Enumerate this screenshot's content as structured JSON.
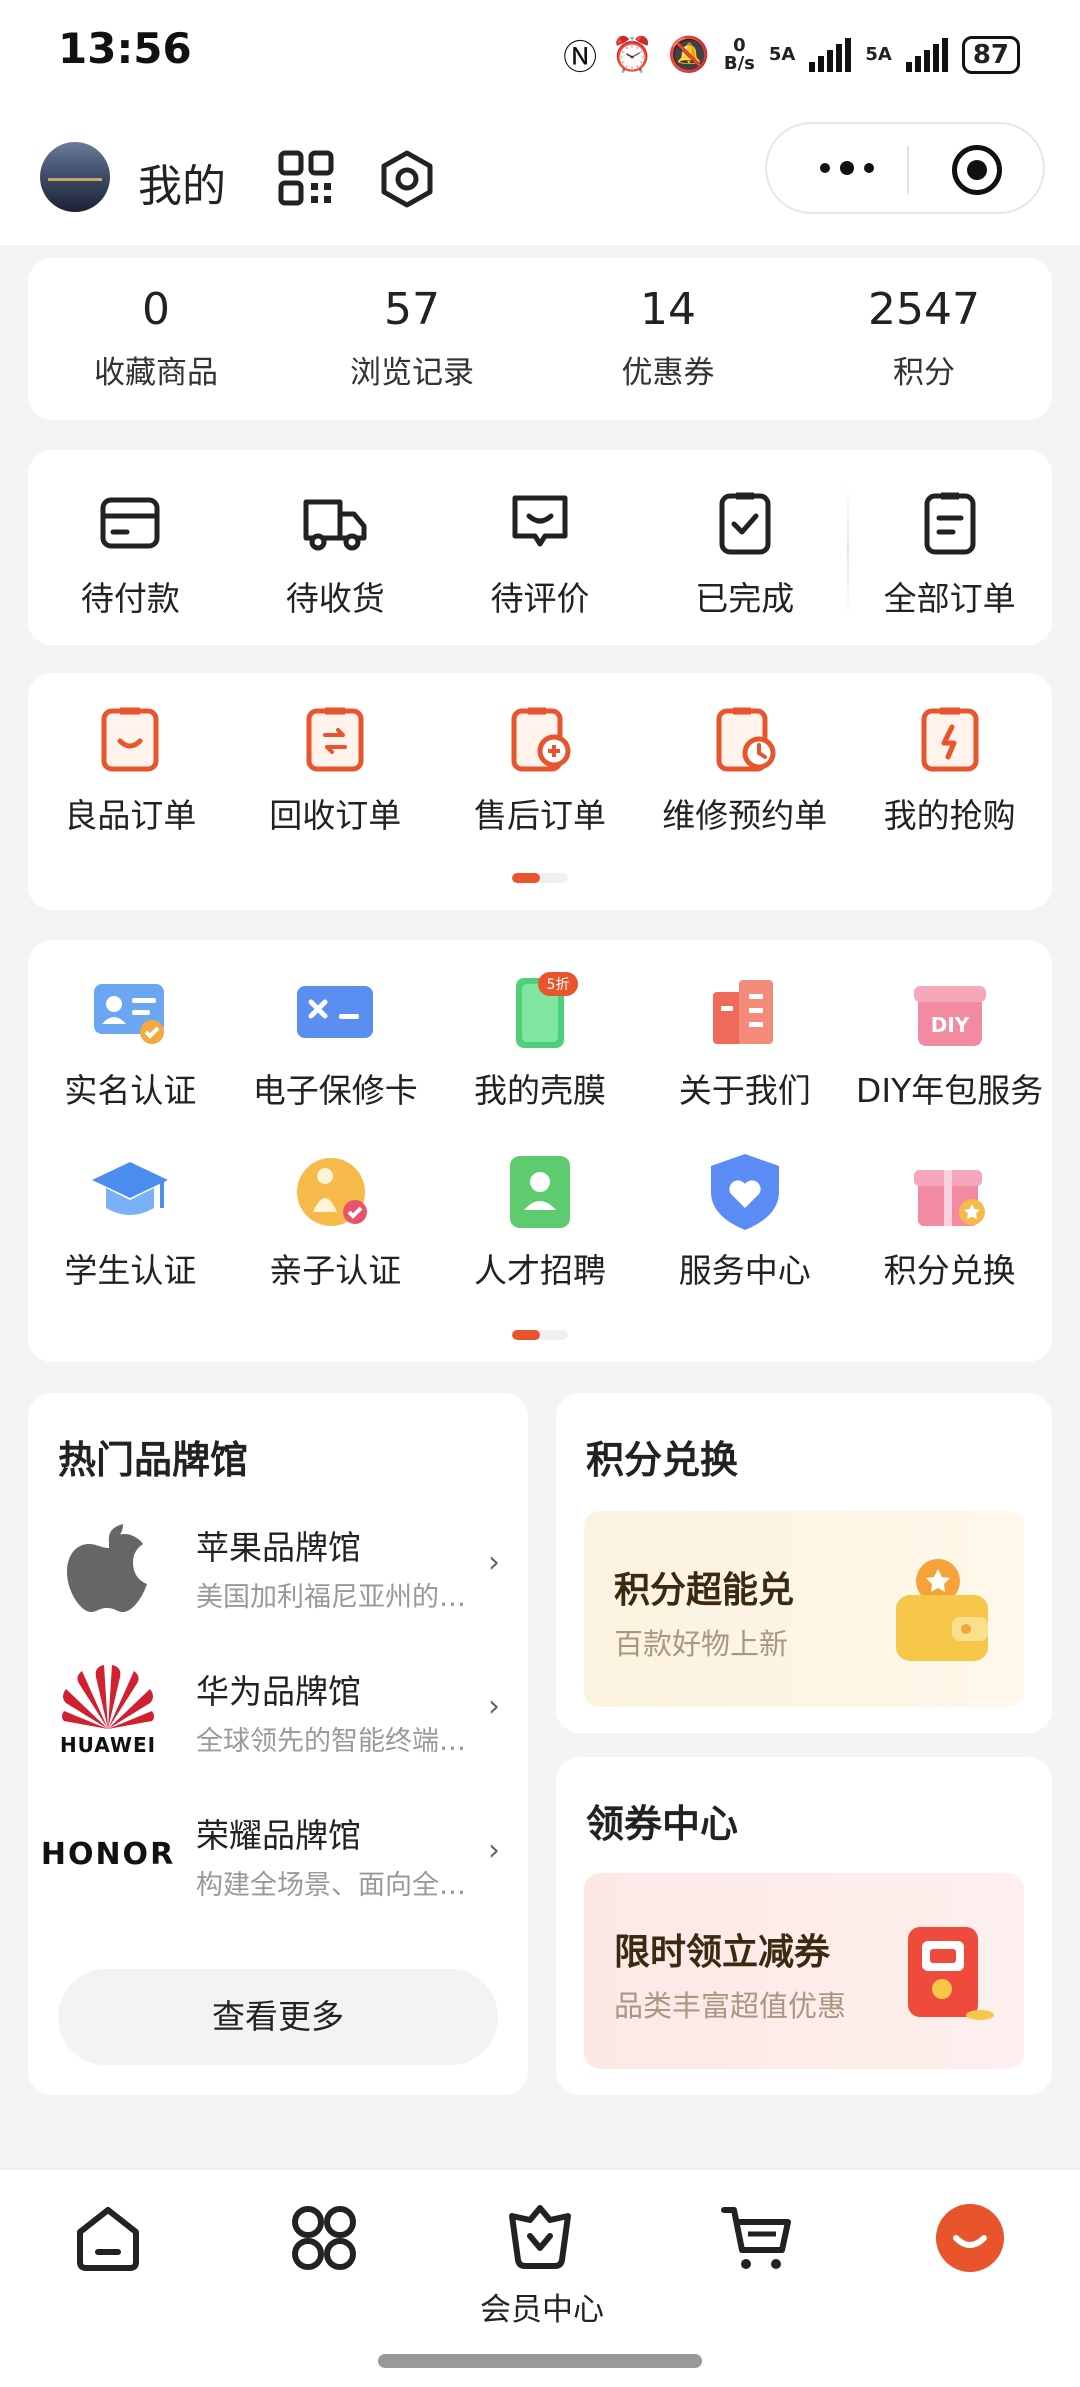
{
  "status_bar": {
    "time": "13:56",
    "net_speed_value": "0",
    "net_speed_unit": "B/s",
    "sim1": "5A",
    "sim2": "5A",
    "battery": "87"
  },
  "header": {
    "title": "我的"
  },
  "stats": [
    {
      "num": "0",
      "label": "收藏商品"
    },
    {
      "num": "57",
      "label": "浏览记录"
    },
    {
      "num": "14",
      "label": "优惠券"
    },
    {
      "num": "2547",
      "label": "积分"
    }
  ],
  "orders": [
    {
      "label": "待付款",
      "icon": "card-icon"
    },
    {
      "label": "待收货",
      "icon": "truck-icon"
    },
    {
      "label": "待评价",
      "icon": "comment-icon"
    },
    {
      "label": "已完成",
      "icon": "check-clipboard-icon"
    },
    {
      "label": "全部订单",
      "icon": "clipboard-list-icon"
    }
  ],
  "special_orders": [
    {
      "label": "良品订单",
      "icon": "smile-bag-icon"
    },
    {
      "label": "回收订单",
      "icon": "recycle-bag-icon"
    },
    {
      "label": "售后订单",
      "icon": "wrench-bag-icon"
    },
    {
      "label": "维修预约单",
      "icon": "clock-bag-icon"
    },
    {
      "label": "我的抢购",
      "icon": "flash-bag-icon"
    }
  ],
  "special_orders_page": 0.5,
  "services": [
    {
      "label": "实名认证",
      "icon": "id-card-icon"
    },
    {
      "label": "电子保修卡",
      "icon": "warranty-card-icon"
    },
    {
      "label": "我的壳膜",
      "icon": "phone-case-icon",
      "badge": "5折"
    },
    {
      "label": "关于我们",
      "icon": "building-icon"
    },
    {
      "label": "DIY年包服务",
      "icon": "diy-box-icon",
      "badge": "DIY"
    },
    {
      "label": "学生认证",
      "icon": "graduation-cap-icon"
    },
    {
      "label": "亲子认证",
      "icon": "family-icon"
    },
    {
      "label": "人才招聘",
      "icon": "recruit-icon"
    },
    {
      "label": "服务中心",
      "icon": "heart-shield-icon"
    },
    {
      "label": "积分兑换",
      "icon": "gift-icon"
    }
  ],
  "services_page": 0.5,
  "brands": {
    "title": "热门品牌馆",
    "items": [
      {
        "name": "苹果品牌馆",
        "desc": "美国加利福尼亚州的高科技公司",
        "logo": "apple-logo"
      },
      {
        "name": "华为品牌馆",
        "desc": "全球领先的智能终端提供商",
        "logo": "huawei-logo",
        "logo_text": "HUAWEI"
      },
      {
        "name": "荣耀品牌馆",
        "desc": "构建全场景、面向全球的智能终端",
        "logo": "honor-logo",
        "logo_text": "HONOR"
      }
    ],
    "more": "查看更多"
  },
  "points": {
    "title": "积分兑换",
    "promo_title": "积分超能兑",
    "promo_sub": "百款好物上新"
  },
  "coupons": {
    "title": "领券中心",
    "promo_title": "限时领立减券",
    "promo_sub": "品类丰富超值优惠"
  },
  "tabbar": [
    {
      "icon": "home-icon",
      "label": ""
    },
    {
      "icon": "category-icon",
      "label": ""
    },
    {
      "icon": "member-basket-icon",
      "label": "会员中心"
    },
    {
      "icon": "cart-icon",
      "label": ""
    },
    {
      "icon": "profile-smile-icon",
      "label": ""
    }
  ],
  "colors": {
    "accent": "#e8552c",
    "text": "#222222",
    "muted": "#999999",
    "background": "#f4f4f6"
  }
}
